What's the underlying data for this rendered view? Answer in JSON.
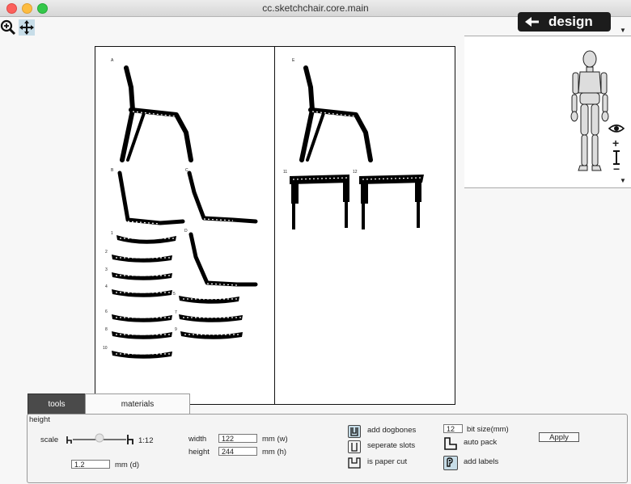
{
  "window": {
    "title": "cc.sketchchair.core.main"
  },
  "toolbar": {
    "zoom_icon": "zoom-in-icon",
    "move_icon": "move-icon"
  },
  "mode_button": {
    "label": "design",
    "icon": "arrow-left-icon"
  },
  "sheets": [
    {
      "part_labels": [
        "A",
        "B",
        "C",
        "D",
        "1",
        "2",
        "3",
        "4",
        "5",
        "6",
        "7",
        "8",
        "9",
        "10"
      ]
    },
    {
      "part_labels": [
        "E",
        "11",
        "12"
      ]
    }
  ],
  "tabs": [
    {
      "label": "tools",
      "active": true
    },
    {
      "label": "materials",
      "active": false
    }
  ],
  "panel": {
    "section_label": "height",
    "scale_label": "scale",
    "scale_value": "1:12",
    "thickness_value": "1.2",
    "thickness_unit": "mm (d)",
    "width_label": "width",
    "width_value": "122",
    "width_unit": "mm (w)",
    "height_label": "height",
    "height_value": "244",
    "height_unit": "mm (h)",
    "options": {
      "dogbones": "add dogbones",
      "separate_slots": "seperate slots",
      "paper_cut": "is paper cut",
      "bit_size_value": "12",
      "bit_size_label": "bit size(mm)",
      "auto_pack": "auto pack",
      "add_labels": "add labels"
    },
    "apply_label": "Apply"
  },
  "colors": {
    "accent_check": "#c7dde8",
    "mode_button_bg": "#1c1c1c"
  }
}
